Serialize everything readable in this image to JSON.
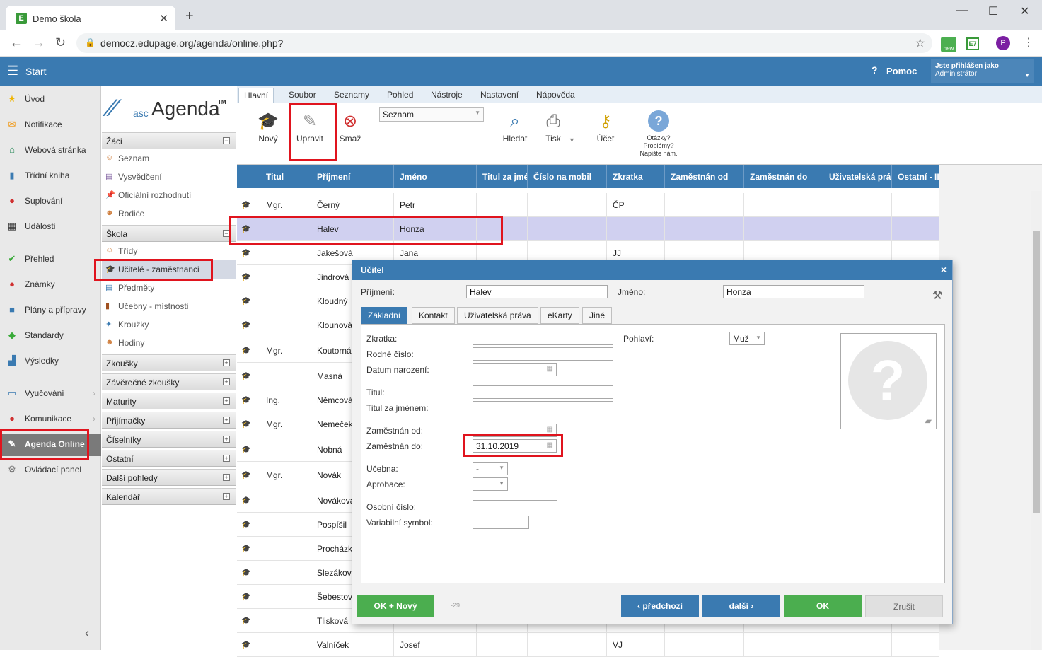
{
  "browser": {
    "tab_title": "Demo škola",
    "tab_favicon": "E",
    "url": "democz.edupage.org/agenda/online.php?",
    "ext_badge": "new",
    "ext2": "E7",
    "profile": "P"
  },
  "header": {
    "start": "Start",
    "help_icon": "?",
    "help": "Pomoc",
    "user_line1": "Jste přihlášen jako",
    "user_line2": "Administrátor"
  },
  "left_nav": [
    {
      "label": "Úvod",
      "icon": "star-icon"
    },
    {
      "label": "Notifikace",
      "icon": "envelope-icon"
    },
    {
      "label": "Webová stránka",
      "icon": "house-icon"
    },
    {
      "label": "Třídní kniha",
      "icon": "book-icon"
    },
    {
      "label": "Suplování",
      "icon": "person-icon"
    },
    {
      "label": "Události",
      "icon": "calendar-icon"
    },
    {
      "label": "Přehled",
      "icon": "check-icon"
    },
    {
      "label": "Známky",
      "icon": "grade-icon"
    },
    {
      "label": "Plány a přípravy",
      "icon": "briefcase-icon"
    },
    {
      "label": "Standardy",
      "icon": "shield-icon"
    },
    {
      "label": "Výsledky",
      "icon": "chart-icon"
    },
    {
      "label": "Vyučování",
      "icon": "book-open-icon"
    },
    {
      "label": "Komunikace",
      "icon": "chat-icon"
    },
    {
      "label": "Agenda Online",
      "icon": "agenda-icon"
    },
    {
      "label": "Ovládací panel",
      "icon": "gear-icon"
    }
  ],
  "logo": {
    "prefix": "asc",
    "name": "Agenda",
    "tm": "TM"
  },
  "second_nav": {
    "zaci": {
      "title": "Žáci",
      "toggle": "−",
      "items": [
        "Seznam",
        "Vysvědčení",
        "Oficiální rozhodnutí",
        "Rodiče"
      ]
    },
    "skola": {
      "title": "Škola",
      "toggle": "−",
      "items": [
        "Třídy",
        "Učitelé - zaměstnanci",
        "Předměty",
        "Učebny - místnosti",
        "Kroužky",
        "Hodiny"
      ]
    },
    "collapsed": [
      "Zkoušky",
      "Závěrečné zkoušky",
      "Maturity",
      "Přijímačky",
      "Číselníky",
      "Ostatní",
      "Další pohledy",
      "Kalendář"
    ],
    "expand": "+"
  },
  "menu_tabs": [
    "Hlavní",
    "Soubor",
    "Seznamy",
    "Pohled",
    "Nástroje",
    "Nastavení",
    "Nápověda"
  ],
  "ribbon": {
    "novy": "Nový",
    "upravit": "Upravit",
    "smaz": "Smaž",
    "view_select": "Seznam",
    "hledat": "Hledat",
    "tisk": "Tisk",
    "ucet": "Účet",
    "help_line1": "Otázky?",
    "help_line2": "Problémy?",
    "help_line3": "Napište nám."
  },
  "table": {
    "columns": [
      "Titul",
      "Příjmení",
      "Jméno",
      "Titul za jménem",
      "Číslo na mobil",
      "Zkratka",
      "Zaměstnán od",
      "Zaměstnán do",
      "Uživatelská práva",
      "Ostatní - II"
    ],
    "rows": [
      {
        "titul": "Mgr.",
        "prijmeni": "Černý",
        "jmeno": "Petr",
        "zkratka": "ČP"
      },
      {
        "titul": "",
        "prijmeni": "Halev",
        "jmeno": "Honza",
        "zkratka": ""
      },
      {
        "titul": "",
        "prijmeni": "Jakešová",
        "jmeno": "Jana",
        "zkratka": "JJ"
      },
      {
        "titul": "",
        "prijmeni": "Jindrová",
        "jmeno": "",
        "zkratka": ""
      },
      {
        "titul": "",
        "prijmeni": "Kloudný",
        "jmeno": "",
        "zkratka": ""
      },
      {
        "titul": "",
        "prijmeni": "Klounová",
        "jmeno": "",
        "zkratka": ""
      },
      {
        "titul": "Mgr.",
        "prijmeni": "Koutorná",
        "jmeno": "",
        "zkratka": ""
      },
      {
        "titul": "",
        "prijmeni": "Masná",
        "jmeno": "",
        "zkratka": ""
      },
      {
        "titul": "Ing.",
        "prijmeni": "Němcová",
        "jmeno": "",
        "zkratka": ""
      },
      {
        "titul": "Mgr.",
        "prijmeni": "Nemeček",
        "jmeno": "",
        "zkratka": ""
      },
      {
        "titul": "",
        "prijmeni": "Nobná",
        "jmeno": "",
        "zkratka": ""
      },
      {
        "titul": "Mgr.",
        "prijmeni": "Novák",
        "jmeno": "",
        "zkratka": ""
      },
      {
        "titul": "",
        "prijmeni": "Nováková",
        "jmeno": "",
        "zkratka": ""
      },
      {
        "titul": "",
        "prijmeni": "Pospíšil",
        "jmeno": "",
        "zkratka": ""
      },
      {
        "titul": "",
        "prijmeni": "Procházka",
        "jmeno": "",
        "zkratka": ""
      },
      {
        "titul": "",
        "prijmeni": "Slezáková",
        "jmeno": "",
        "zkratka": ""
      },
      {
        "titul": "",
        "prijmeni": "Šebestová",
        "jmeno": "",
        "zkratka": ""
      },
      {
        "titul": "",
        "prijmeni": "Tlisková",
        "jmeno": "",
        "zkratka": ""
      },
      {
        "titul": "",
        "prijmeni": "Valníček",
        "jmeno": "Josef",
        "zkratka": "VJ"
      }
    ]
  },
  "dialog": {
    "title": "Učitel",
    "close": "×",
    "prijmeni_label": "Příjmení:",
    "prijmeni": "Halev",
    "jmeno_label": "Jméno:",
    "jmeno": "Honza",
    "tabs": [
      "Základní",
      "Kontakt",
      "Uživatelská práva",
      "eKarty",
      "Jiné"
    ],
    "fields": {
      "zkratka": "Zkratka:",
      "rodne_cislo": "Rodné číslo:",
      "datum_narozeni": "Datum narození:",
      "titul": "Titul:",
      "titul_za": "Titul za jménem:",
      "zamestnan_od": "Zaměstnán od:",
      "zamestnan_do": "Zaměstnán do:",
      "zamestnan_do_value": "31.10.2019",
      "ucebna": "Učebna:",
      "ucebna_value": "-",
      "aprobace": "Aprobace:",
      "osobni_cislo": "Osobní číslo:",
      "variabilni_symbol": "Variabilní symbol:",
      "pohlavi": "Pohlaví:",
      "pohlavi_value": "Muž"
    },
    "buttons": {
      "ok_novy": "OK + Nový",
      "counter": "-29",
      "predchozi": "předchozí",
      "dalsi": "další",
      "ok": "OK",
      "zrusit": "Zrušit"
    }
  },
  "colors": {
    "accent": "#3a7ab1",
    "highlight": "#e0141e",
    "ok": "#4bae4f",
    "selected_row": "#d0d0f0"
  }
}
